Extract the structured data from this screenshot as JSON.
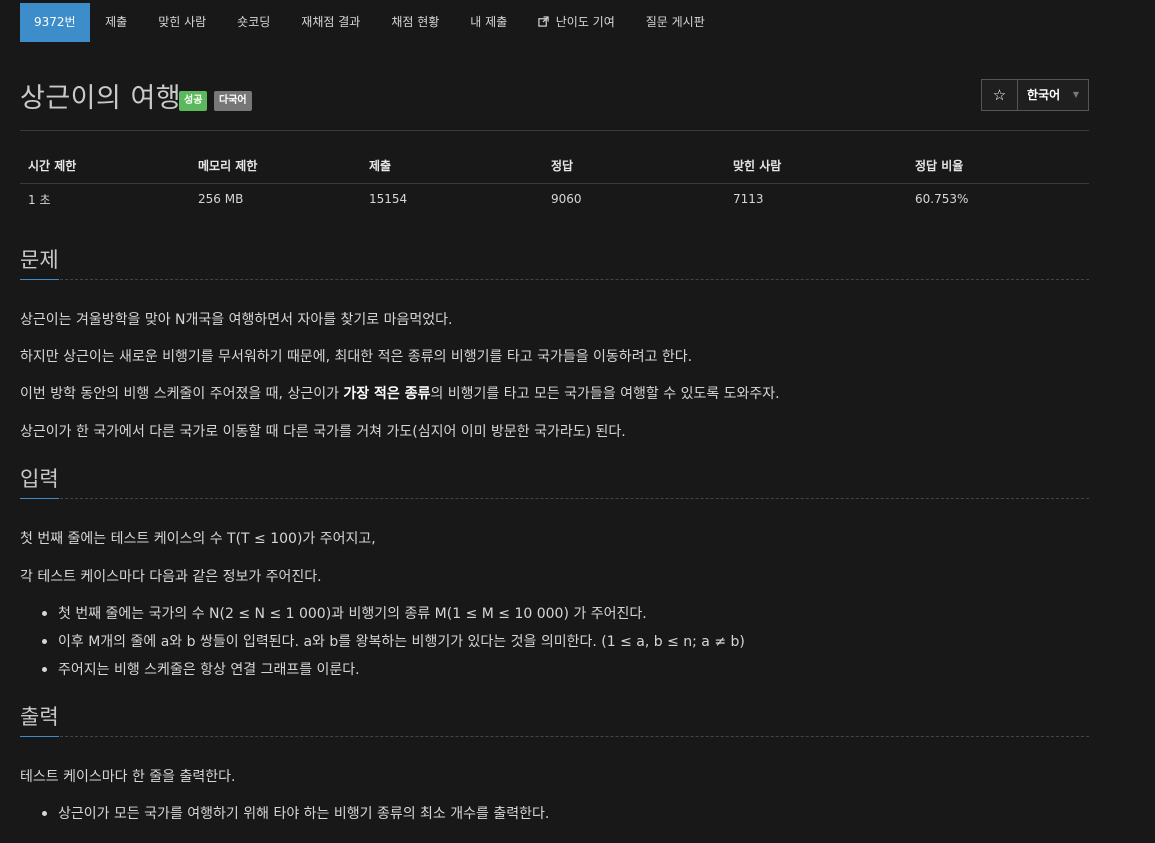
{
  "tabs": [
    {
      "label": "9372번",
      "active": true
    },
    {
      "label": "제출"
    },
    {
      "label": "맞힌 사람"
    },
    {
      "label": "숏코딩"
    },
    {
      "label": "재채점 결과"
    },
    {
      "label": "채점 현황"
    },
    {
      "label": "내 제출"
    },
    {
      "label": "난이도 기여",
      "icon": "external-link-icon"
    },
    {
      "label": "질문 게시판"
    }
  ],
  "problem": {
    "title": "상근이의 여행",
    "badges": {
      "success": "성공",
      "multilang": "다국어"
    },
    "star_icon": "☆",
    "language": "한국어"
  },
  "stats": {
    "headers": [
      "시간 제한",
      "메모리 제한",
      "제출",
      "정답",
      "맞힌 사람",
      "정답 비율"
    ],
    "values": [
      "1 초",
      "256 MB",
      "15154",
      "9060",
      "7113",
      "60.753%"
    ]
  },
  "description": {
    "heading": "문제",
    "p1": "상근이는 겨울방학을 맞아 N개국을 여행하면서 자아를 찾기로 마음먹었다.",
    "p2": "하지만 상근이는 새로운 비행기를 무서워하기 때문에, 최대한 적은 종류의 비행기를 타고 국가들을 이동하려고 한다.",
    "p3_before": "이번 방학 동안의 비행 스케줄이 주어졌을 때, 상근이가 ",
    "p3_bold": "가장 적은 종류",
    "p3_after": "의 비행기를 타고 모든 국가들을 여행할 수 있도록 도와주자.",
    "p4": "상근이가 한 국가에서 다른 국가로 이동할 때 다른 국가를 거쳐 가도(심지어 이미 방문한 국가라도) 된다."
  },
  "input": {
    "heading": "입력",
    "p1": "첫 번째 줄에는 테스트 케이스의 수 T(T ≤ 100)가 주어지고,",
    "p2": "각 테스트 케이스마다 다음과 같은 정보가 주어진다.",
    "items": [
      "첫 번째 줄에는 국가의 수 N(2 ≤ N ≤ 1 000)과 비행기의 종류 M(1 ≤ M ≤ 10 000) 가 주어진다.",
      "이후 M개의 줄에 a와 b 쌍들이 입력된다. a와 b를 왕복하는 비행기가 있다는 것을 의미한다. (1 ≤ a, b ≤ n; a ≠ b)",
      "주어지는 비행 스케줄은 항상 연결 그래프를 이룬다."
    ]
  },
  "output": {
    "heading": "출력",
    "p1": "테스트 케이스마다 한 줄을 출력한다.",
    "items": [
      "상근이가 모든 국가를 여행하기 위해 타야 하는 비행기 종류의 최소 개수를 출력한다."
    ]
  }
}
